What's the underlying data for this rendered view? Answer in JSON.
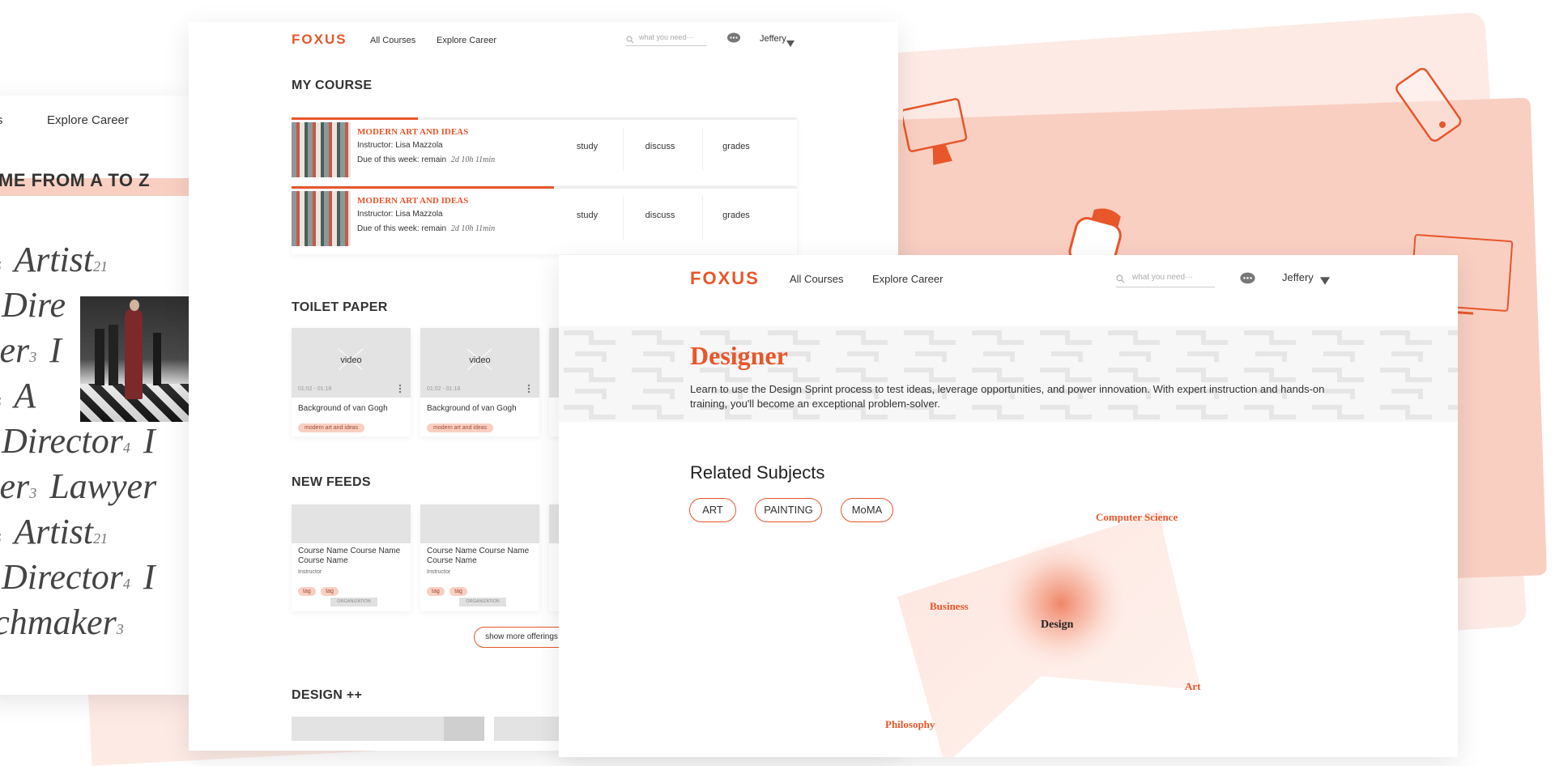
{
  "colors": {
    "accent": "#e8562a",
    "salmon": "#f9cfc2",
    "salmon_light": "#fdeae5"
  },
  "left_screen": {
    "nav": [
      "ses",
      "Explore Career"
    ],
    "heading": "ME FROM A TO Z",
    "lines": [
      [
        {
          "w": "t",
          "n": "6"
        },
        {
          "w": "Artist",
          "n": "21"
        }
      ],
      [
        {
          "w": "Dire",
          "n": ""
        }
      ],
      [
        {
          "w": "ker",
          "n": "3"
        },
        {
          "w": "I",
          "n": ""
        }
      ],
      [
        {
          "w": "t",
          "n": "6"
        },
        {
          "w": "A",
          "n": ""
        }
      ],
      [
        {
          "w": "Director",
          "n": "4"
        },
        {
          "w": "I",
          "n": ""
        }
      ],
      [
        {
          "w": "ker",
          "n": "3"
        },
        {
          "w": "Lawyer",
          "n": ""
        }
      ],
      [
        {
          "w": "t",
          "n": "6"
        },
        {
          "w": "Artist",
          "n": "21"
        }
      ],
      [
        {
          "w": "Director",
          "n": "4"
        },
        {
          "w": "I",
          "n": ""
        }
      ],
      [
        {
          "w": "tchmaker",
          "n": "3"
        }
      ]
    ]
  },
  "mid_screen": {
    "logo": "FOXUS",
    "nav": {
      "all_courses": "All Courses",
      "explore_career": "Explore Career"
    },
    "search_placeholder": "what you need···",
    "user": "Jeffery",
    "my_course_title": "MY COURSE",
    "courses": [
      {
        "name": "MODERN ART AND IDEAS",
        "instructor": "Instructor: Lisa Mazzola",
        "due_label": "Due of this week: remain",
        "due_time": "2d 10h 11min",
        "progress": 0.25,
        "tabs": [
          "study",
          "discuss",
          "grades"
        ]
      },
      {
        "name": "MODERN ART AND IDEAS",
        "instructor": "Instructor: Lisa Mazzola",
        "due_label": "Due of this week: remain",
        "due_time": "2d 10h 11min",
        "progress": 0.52,
        "tabs": [
          "study",
          "discuss",
          "grades"
        ]
      }
    ],
    "toilet_paper_title": "TOILET PAPER",
    "videos": [
      {
        "label": "video",
        "time": "01:02 - 01:18",
        "title": "Background of van Gogh",
        "tag": "modern art and ideas"
      },
      {
        "label": "video",
        "time": "01:02 - 01:18",
        "title": "Background of van Gogh",
        "tag": "modern art and ideas"
      }
    ],
    "new_feeds_title": "NEW FEEDS",
    "feeds": [
      {
        "title": "Course Name Course Name Course Name",
        "instructor": "Instructor",
        "tags": [
          "tag",
          "tag"
        ],
        "org": "ORGANIZATION"
      },
      {
        "title": "Course Name Course Name Course Name",
        "instructor": "Instructor",
        "tags": [
          "tag",
          "tag"
        ],
        "org": "ORGANIZATION"
      }
    ],
    "show_more": "show more offerings",
    "design_title": "DESIGN ++"
  },
  "right_screen": {
    "logo": "FOXUS",
    "nav": {
      "all_courses": "All Courses",
      "explore_career": "Explore Career"
    },
    "search_placeholder": "what you need···",
    "user": "Jeffery",
    "title": "Designer",
    "description": "Learn to use the Design Sprint process to test ideas, leverage opportunities, and power innovation. With expert instruction and hands-on training, you'll become an exceptional problem-solver.",
    "related_title": "Related Subjects",
    "chips": [
      "ART",
      "PAINTING",
      "MoMA"
    ],
    "graph": {
      "center": "Design",
      "nodes": [
        "Computer Science",
        "Business",
        "Art",
        "Philosophy"
      ]
    }
  },
  "icons": [
    "monitor-icon",
    "tablet-icon",
    "smartwatch-icon",
    "laptop-screen-icon",
    "search-icon",
    "chat-icon",
    "caret-down-icon",
    "more-vertical-icon"
  ]
}
